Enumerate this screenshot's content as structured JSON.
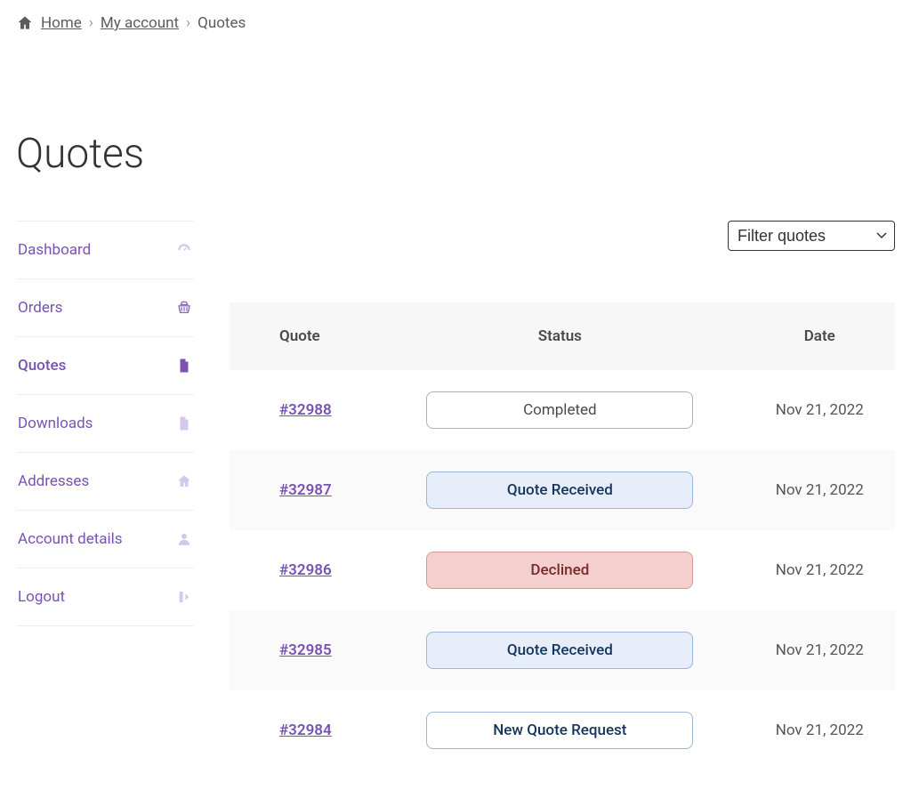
{
  "breadcrumb": {
    "home": "Home",
    "my_account": "My account",
    "current": "Quotes"
  },
  "page_title": "Quotes",
  "sidebar": {
    "items": [
      {
        "label": "Dashboard",
        "icon": "dashboard-icon",
        "active": false
      },
      {
        "label": "Orders",
        "icon": "basket-icon",
        "active": false
      },
      {
        "label": "Quotes",
        "icon": "document-icon",
        "active": true
      },
      {
        "label": "Downloads",
        "icon": "file-icon",
        "active": false
      },
      {
        "label": "Addresses",
        "icon": "home-icon",
        "active": false
      },
      {
        "label": "Account details",
        "icon": "user-icon",
        "active": false
      },
      {
        "label": "Logout",
        "icon": "logout-icon",
        "active": false
      }
    ]
  },
  "filter": {
    "placeholder": "Filter quotes"
  },
  "table": {
    "headers": {
      "quote": "Quote",
      "status": "Status",
      "date": "Date"
    },
    "rows": [
      {
        "id": "#32988",
        "status": "Completed",
        "status_class": "status-completed",
        "date": "Nov 21, 2022"
      },
      {
        "id": "#32987",
        "status": "Quote Received",
        "status_class": "status-received",
        "date": "Nov 21, 2022"
      },
      {
        "id": "#32986",
        "status": "Declined",
        "status_class": "status-declined",
        "date": "Nov 21, 2022"
      },
      {
        "id": "#32985",
        "status": "Quote Received",
        "status_class": "status-received",
        "date": "Nov 21, 2022"
      },
      {
        "id": "#32984",
        "status": "New Quote Request",
        "status_class": "status-new",
        "date": "Nov 21, 2022"
      }
    ]
  }
}
